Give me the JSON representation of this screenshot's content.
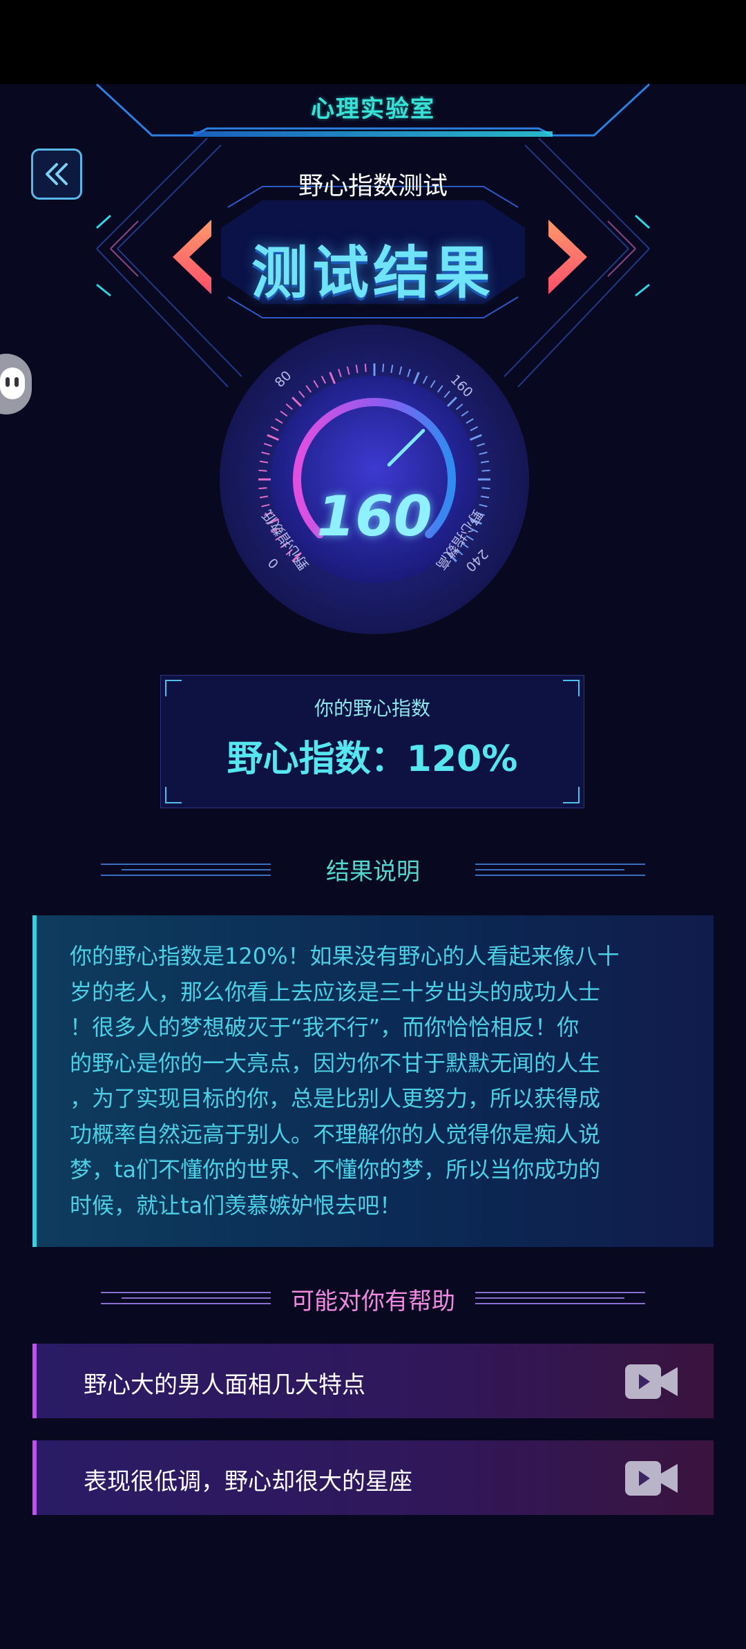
{
  "header": {
    "brand": "心理实验室",
    "subtitle": "野心指数测试",
    "title": "测试结果"
  },
  "gauge": {
    "value": "160",
    "ticks": [
      "0",
      "80",
      "160",
      "240"
    ],
    "label_left": "野心指数低",
    "label_right": "野心指数高",
    "level_fraction": 0.667
  },
  "score_card": {
    "caption": "你的野心指数",
    "text": "野心指数：120%"
  },
  "result_section": {
    "title": "结果说明",
    "text": "你的野心指数是120%！如果没有野心的人看起来像八十\n岁的老人，那么你看上去应该是三十岁出头的成功人士\n！很多人的梦想破灭于“我不行”，而你恰恰相反！你\n的野心是你的一大亮点，因为你不甘于默默无闻的人生\n，为了实现目标的你，总是比别人更努力，所以获得成\n功概率自然远高于别人。不理解你的人觉得你是痴人说\n梦，ta们不懂你的世界、不懂你的梦，所以当你成功的\n时候，就让ta们羡慕嫉妒恨去吧！"
  },
  "help_section": {
    "title": "可能对你有帮助",
    "items": [
      {
        "label": "野心大的男人面相几大特点",
        "icon": "video-camera-icon"
      },
      {
        "label": "表现很低调，野心却很大的星座",
        "icon": "video-camera-icon"
      }
    ]
  },
  "colors": {
    "background": "#080820",
    "accent_cyan": "#37e3d7",
    "accent_pink": "#e36cc9",
    "arrow_orange": "#ff7a5a"
  }
}
